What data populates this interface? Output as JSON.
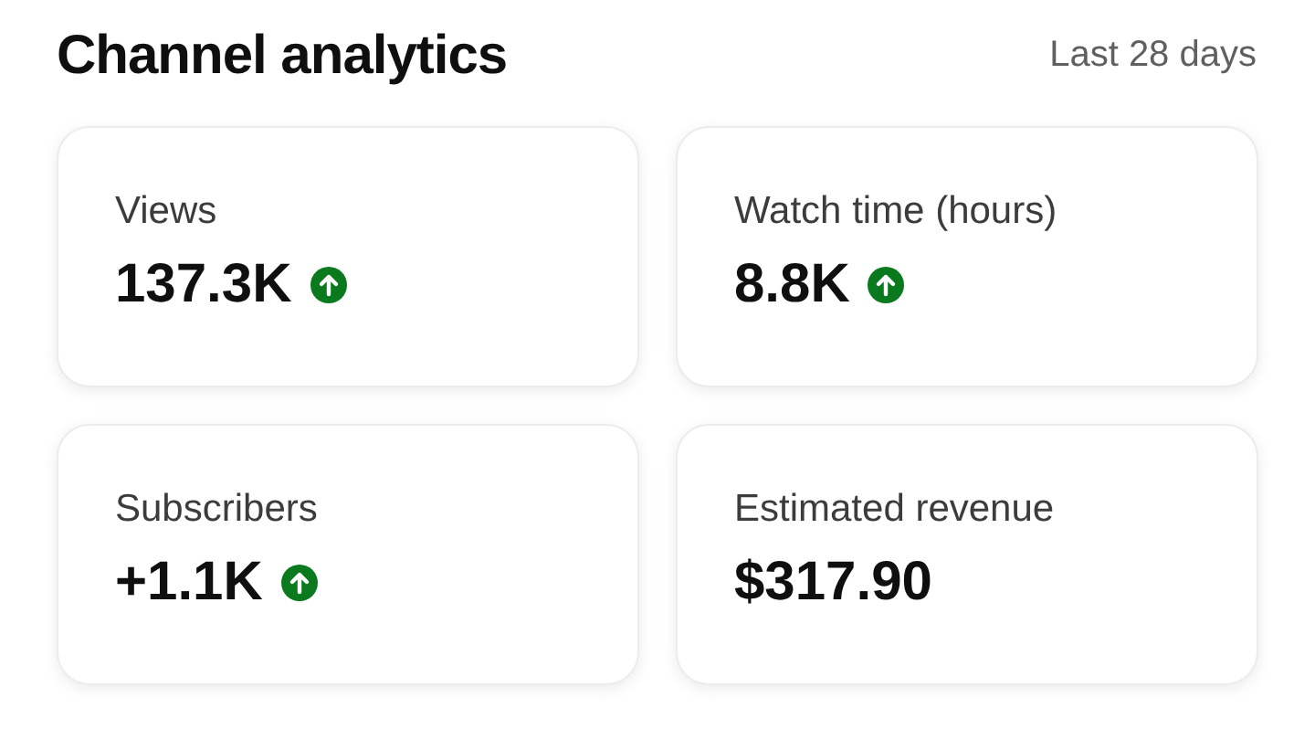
{
  "header": {
    "title": "Channel analytics",
    "period": "Last 28 days"
  },
  "metrics": [
    {
      "label": "Views",
      "value": "137.3K",
      "trending_up": true
    },
    {
      "label": "Watch time (hours)",
      "value": "8.8K",
      "trending_up": true
    },
    {
      "label": "Subscribers",
      "value": "+1.1K",
      "trending_up": true
    },
    {
      "label": "Estimated revenue",
      "value": "$317.90",
      "trending_up": false
    }
  ]
}
